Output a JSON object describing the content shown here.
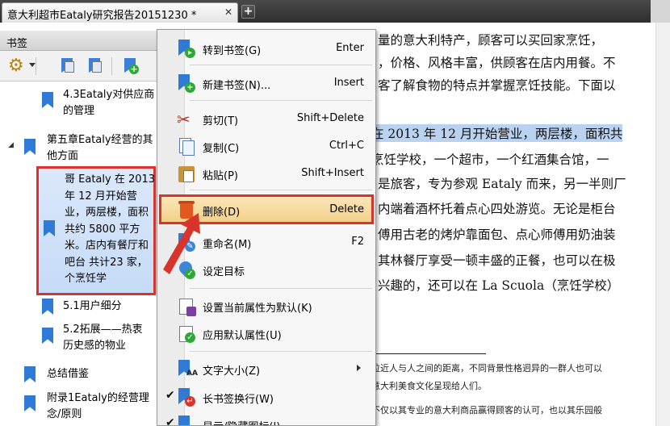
{
  "tab": {
    "title": "意大利超市Eataly研究报告20151230 *",
    "close": "✕",
    "new": "+"
  },
  "panel": {
    "title": "书签"
  },
  "tree": [
    {
      "text_lines": [
        "4.3Eataly对供应商",
        "的管理"
      ]
    },
    {
      "text_lines": [
        "第五章Eataly经营的其",
        "他方面"
      ],
      "expander": "◢"
    },
    {
      "text_lines": [
        "哥 Eataly 在 2013",
        "年 12 月开始营",
        "业，两层楼，面积",
        "共约 5800 平方",
        "米。店内有餐厅和",
        "吧台 共计23 家，",
        "个烹饪学"
      ],
      "selected": true
    },
    {
      "text_lines": [
        "5.1用户细分"
      ]
    },
    {
      "text_lines": [
        "5.2拓展——热衷",
        "历史感的物业"
      ]
    },
    {
      "text_lines": [
        "总结借鉴"
      ]
    },
    {
      "text_lines": [
        "附录1Eataly的经营理",
        "念/原则"
      ]
    }
  ],
  "menu": {
    "items": [
      {
        "id": "goto",
        "icon": "bookmark-go-icon",
        "label": "转到书签(G)",
        "key": "Enter"
      },
      {
        "id": "new",
        "icon": "bookmark-new-icon",
        "label": "新建书签(N)...",
        "key": "Insert"
      },
      {
        "id": "cut",
        "icon": "scissors-icon",
        "label": "剪切(T)",
        "key": "Shift+Delete"
      },
      {
        "id": "copy",
        "icon": "copy-icon",
        "label": "复制(C)",
        "key": "Ctrl+C"
      },
      {
        "id": "paste",
        "icon": "paste-icon",
        "label": "粘贴(P)",
        "key": "Shift+Insert"
      },
      {
        "id": "delete",
        "icon": "trash-icon",
        "label": "删除(D)",
        "key": "Delete"
      },
      {
        "id": "rename",
        "icon": "bookmark-rename-icon",
        "label": "重命名(M)",
        "key": "F2"
      },
      {
        "id": "target",
        "icon": "target-pin-icon",
        "label": "设定目标",
        "key": ""
      },
      {
        "id": "setdefault",
        "icon": "properties-save-icon",
        "label": "设置当前属性为默认(K)",
        "key": ""
      },
      {
        "id": "applydefault",
        "icon": "properties-apply-icon",
        "label": "应用默认属性(U)",
        "key": ""
      },
      {
        "id": "textsize",
        "icon": "text-size-icon",
        "label": "文字大小(Z)",
        "key": ""
      },
      {
        "id": "wrap",
        "icon": "bookmark-wrap-icon",
        "label": "长书签换行(W)",
        "key": "",
        "checked": true
      },
      {
        "id": "showhide",
        "icon": "show-hide-icon",
        "label": "显示/隐藏图标(I)",
        "key": "",
        "checked": true
      }
    ],
    "check_glyph": "✔"
  },
  "doc": {
    "lines": [
      "量的意大利特产，顾客可以买回家烹饪，",
      "，价格、风格丰富，供顾客在店内用餐。不",
      "客了解食物的特点并掌握烹饪技能。下面以",
      "在 2013 年 12 月开始营业，两层楼，面积共",
      "烹饪学校，一个超市，一个红酒集合馆，一",
      "是旅客，专为参观 Eataly 而来，另一半则厂",
      "内端着酒杯托着点心四处游览。无论是柜台",
      "傅用古老的烤炉靠面包、点心师傅用奶油装",
      "其林餐厅享受一顿丰盛的正餐，也可以在极",
      "兴趣的，还可以在 La Scuola（烹饪学校）"
    ],
    "footnotes": [
      "拉近人与人之间的距离，不同背景性格迥异的一群人也可以",
      "意大利美食文化呈现给人们。",
      "不仅以其专业的意大利商品赢得顾客的认可，也以其乐园般"
    ]
  }
}
